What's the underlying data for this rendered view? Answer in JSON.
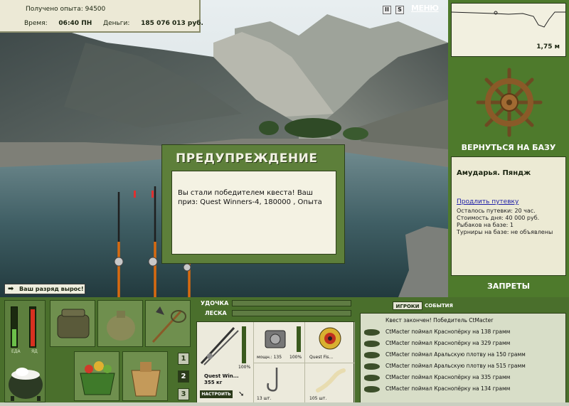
{
  "info": {
    "exp_label": "Получено опыта:",
    "exp_value": "94500",
    "time_label": "Время:",
    "time_value": "06:40 ПН",
    "money_label": "Деньги:",
    "money_value": "185 076 013 руб."
  },
  "top_icons": {
    "pause": "II",
    "sound": "S",
    "menu": "МЕНЮ"
  },
  "depth": {
    "value": "1,75 м"
  },
  "right_panel": {
    "return_button": "ВЕРНУТЬСЯ НА БАЗУ",
    "location": "Амударья. Пяндж",
    "extend_link": "Продлить путевку",
    "lines": [
      "Осталось путевки: 20 час.",
      "Стоимость дня: 40 000 руб.",
      "Рыбаков на базе: 1",
      "Турниры на базе: не объявлены"
    ],
    "bans_button": "ЗАПРЕТЫ"
  },
  "warning": {
    "title": "ПРЕДУПРЕЖДЕНИЕ",
    "message": "Вы стали победителем квеста! Ваш приз: Quest Winners-4, 180000 , Опыта"
  },
  "toast": {
    "text": "Ваш разряд вырос!"
  },
  "status": {
    "food_label": "ЕДА",
    "poison_label": "ЯД",
    "food_level": 0.42,
    "poison_level": 0.92
  },
  "slot_numbers": [
    "1",
    "2",
    "3"
  ],
  "tackle": {
    "rod_label": "УДОЧКА",
    "line_label": "ЛЕСКА",
    "rod_name": "Quest Win...",
    "rod_weight": "355 кг",
    "rod_percent": "100%",
    "reel_power": "мощн.: 135",
    "reel_percent": "100%",
    "line_name": "Quest Fis...",
    "hook_count": "13 шт.",
    "bait_count": "105 шт.",
    "setup_button": "НАСТРОИТЬ"
  },
  "feed": {
    "tabs": [
      "ИГРОКИ",
      "СОБЫТИЯ"
    ],
    "header": "Квест закончен! Победитель CtMacter",
    "entries": [
      "CtMacter поймал Краснопёрку на 138 грамм",
      "CtMacter поймал Краснопёрку на 329 грамм",
      "CtMacter поймал Аральскую плотву на 150 грамм",
      "CtMacter поймал Аральскую плотву на 515 грамм",
      "CtMacter поймал Краснопёрку на 335 грамм",
      "CtMacter поймал Краснопёрку на 134 грамм"
    ]
  },
  "colors": {
    "panel_green": "#4e7a2c",
    "cream": "#ecead4",
    "food_bar": "#6cc04a",
    "poison_bar": "#d83020"
  }
}
